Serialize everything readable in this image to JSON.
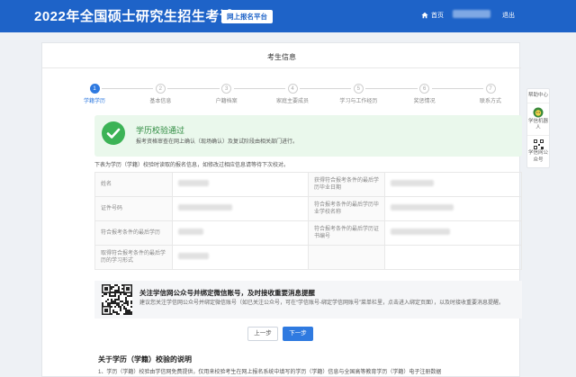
{
  "header": {
    "title": "2022年全国硕士研究生招生考试",
    "platform_tag": "网上报名平台",
    "home_label": "首页",
    "logout_label": "退出"
  },
  "page": {
    "title": "考生信息"
  },
  "steps": [
    {
      "num": "1",
      "label": "学籍学历",
      "active": true
    },
    {
      "num": "2",
      "label": "基本信息",
      "active": false
    },
    {
      "num": "3",
      "label": "户籍档案",
      "active": false
    },
    {
      "num": "4",
      "label": "家庭主要成员",
      "active": false
    },
    {
      "num": "5",
      "label": "学习与工作经历",
      "active": false
    },
    {
      "num": "6",
      "label": "奖惩情况",
      "active": false
    },
    {
      "num": "7",
      "label": "联系方式",
      "active": false
    }
  ],
  "success": {
    "title": "学历校验通过",
    "desc": "报考资格审查在网上确认（现场确认）及复试阶段由相关部门进行。"
  },
  "info_note": "下表为学历（学籍）校验时读取的报名信息，如修改过相应信息请等待下次校对。",
  "info_rows": [
    {
      "l1": "姓名",
      "l2": "获得符合报考条件的最后学历毕业日期"
    },
    {
      "l1": "证件号码",
      "l2": "符合报考条件的最后学历毕业学校名称"
    },
    {
      "l1": "符合报考条件的最后学历",
      "l2": "符合报考条件的最后学历证书编号"
    },
    {
      "l1": "取得符合报考条件的最后学历的学习形式",
      "l2": ""
    }
  ],
  "wechat": {
    "title": "关注学信网公众号并绑定微信账号，及时接收重要消息提醒",
    "desc": "建议您关注学信网公众号并绑定微信账号（如已关注公众号，可在“学信账号-绑定学信网账号”菜单栏里，点击进入绑定页面），以及时接收重要消息提醒。"
  },
  "buttons": {
    "prev": "上一步",
    "next": "下一步"
  },
  "notes": {
    "title": "关于学历（学籍）校验的说明",
    "line1": "1、学历（学籍）校验由学信网免费提供，仅用来校验考生在网上报名系统中填写的学历（学籍）信息与全国高等教育学历（学籍）电子注册数据"
  },
  "sidebar": {
    "help": "帮助中心",
    "robot": "学信机器人",
    "wechat_account": "学信网公众号"
  },
  "colors": {
    "primary": "#1e63c8",
    "accent": "#2f7ae0",
    "success": "#3cb356"
  }
}
